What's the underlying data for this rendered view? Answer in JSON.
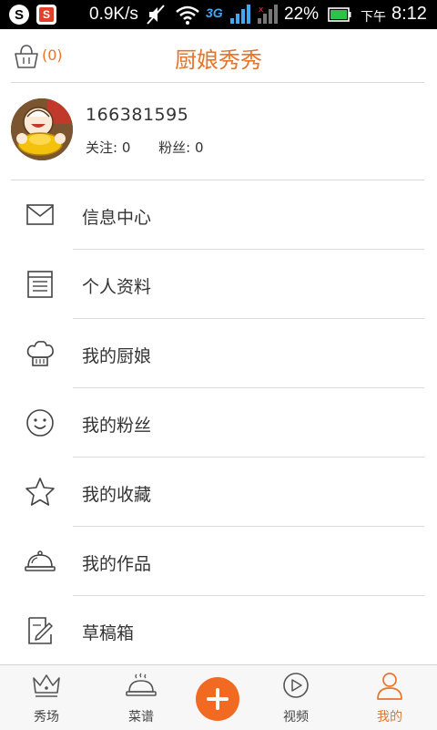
{
  "status_bar": {
    "speed": "0.9K/s",
    "network": "3G",
    "battery_percent": "22%",
    "ampm": "下午",
    "time": "8:12",
    "app_icon_1": "S",
    "app_icon_2": "S"
  },
  "header": {
    "cart_count": "(0)",
    "title": "厨娘秀秀"
  },
  "profile": {
    "user_id": "166381595",
    "following": "关注: 0",
    "fans": "粉丝: 0"
  },
  "menu": [
    {
      "label": "信息中心",
      "icon": "mail-icon"
    },
    {
      "label": "个人资料",
      "icon": "profile-card-icon"
    },
    {
      "label": "我的厨娘",
      "icon": "chef-hat-icon"
    },
    {
      "label": "我的粉丝",
      "icon": "smiley-icon"
    },
    {
      "label": "我的收藏",
      "icon": "star-icon"
    },
    {
      "label": "我的作品",
      "icon": "cloche-icon"
    },
    {
      "label": "草稿箱",
      "icon": "draft-edit-icon"
    }
  ],
  "bottom_nav": {
    "show": "秀场",
    "recipes": "菜谱",
    "video": "视频",
    "mine": "我的",
    "active": "mine"
  },
  "colors": {
    "accent": "#e8742a",
    "plus_button": "#f26a22"
  }
}
